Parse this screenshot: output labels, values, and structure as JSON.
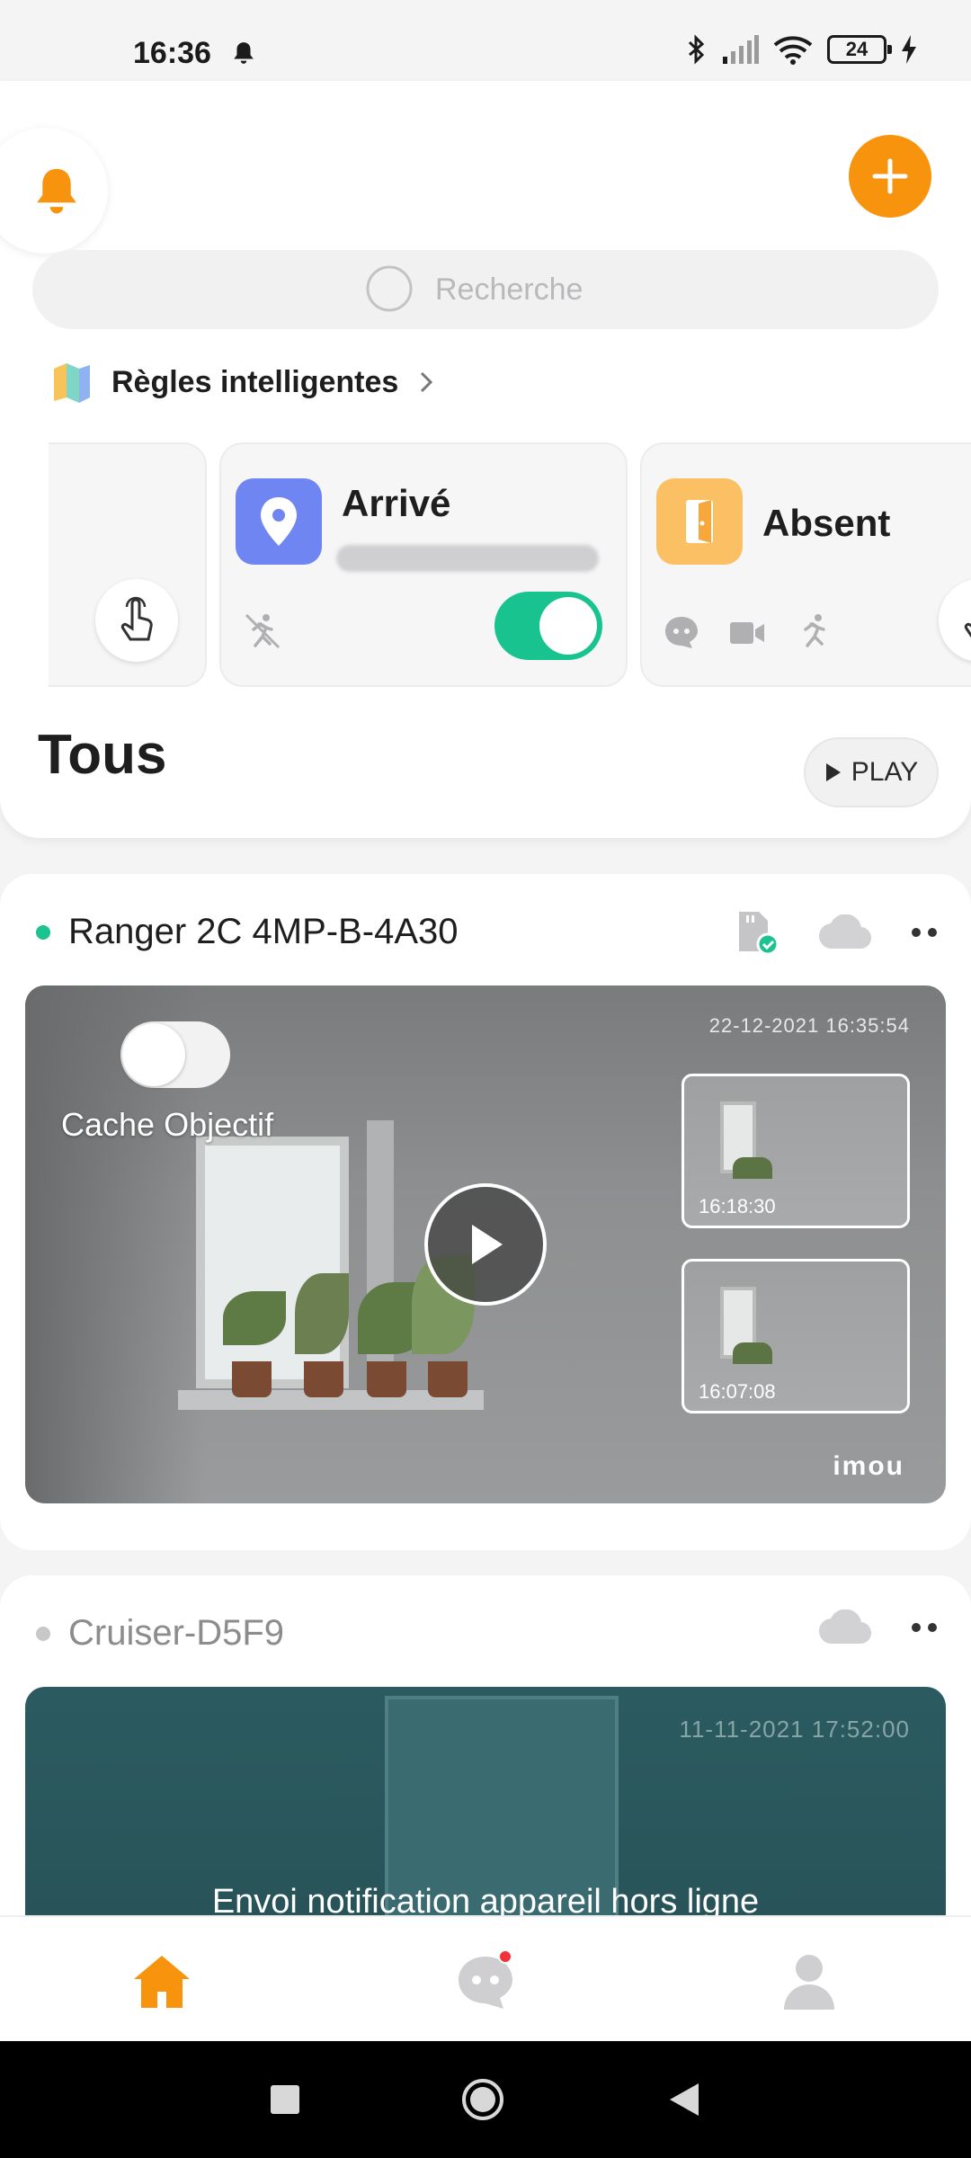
{
  "status_bar": {
    "time": "16:36",
    "battery": "24",
    "icons": [
      "bell-icon",
      "bluetooth-icon",
      "signal-icon",
      "wifi-icon",
      "battery-icon",
      "charging-icon"
    ]
  },
  "header": {
    "search_placeholder": "Recherche"
  },
  "smart_rules": {
    "title": "Règles intelligentes",
    "cards": [
      {
        "title": "Arrivé",
        "icon": "location-pin-icon",
        "color": "#6f86f2",
        "toggle_on": true,
        "subtitle_obscured": true
      },
      {
        "title": "Absent",
        "icon": "door-icon",
        "color": "#fbc063"
      }
    ]
  },
  "section": {
    "title": "Tous",
    "play_label": "PLAY"
  },
  "devices": [
    {
      "name": "Ranger 2C 4MP-B-4A30",
      "online": true,
      "status_color": "#1cc28f",
      "timestamp": "22-12-2021 16:35:54",
      "privacy_label": "Cache Objectif",
      "privacy_on": false,
      "thumbnails": [
        {
          "time": "16:18:30"
        },
        {
          "time": "16:07:08"
        }
      ],
      "watermark": "imou"
    },
    {
      "name": "Cruiser-D5F9",
      "online": false,
      "status_color": "#c8c8c8",
      "timestamp": "11-11-2021 17:52:00",
      "overlay_text": "Envoi notification appareil hors ligne"
    }
  ],
  "colors": {
    "accent": "#f7930d",
    "toggle_on": "#18c38f"
  },
  "bottom_nav": [
    {
      "icon": "home-icon",
      "active": true
    },
    {
      "icon": "message-icon",
      "badge": true
    },
    {
      "icon": "profile-icon"
    }
  ]
}
